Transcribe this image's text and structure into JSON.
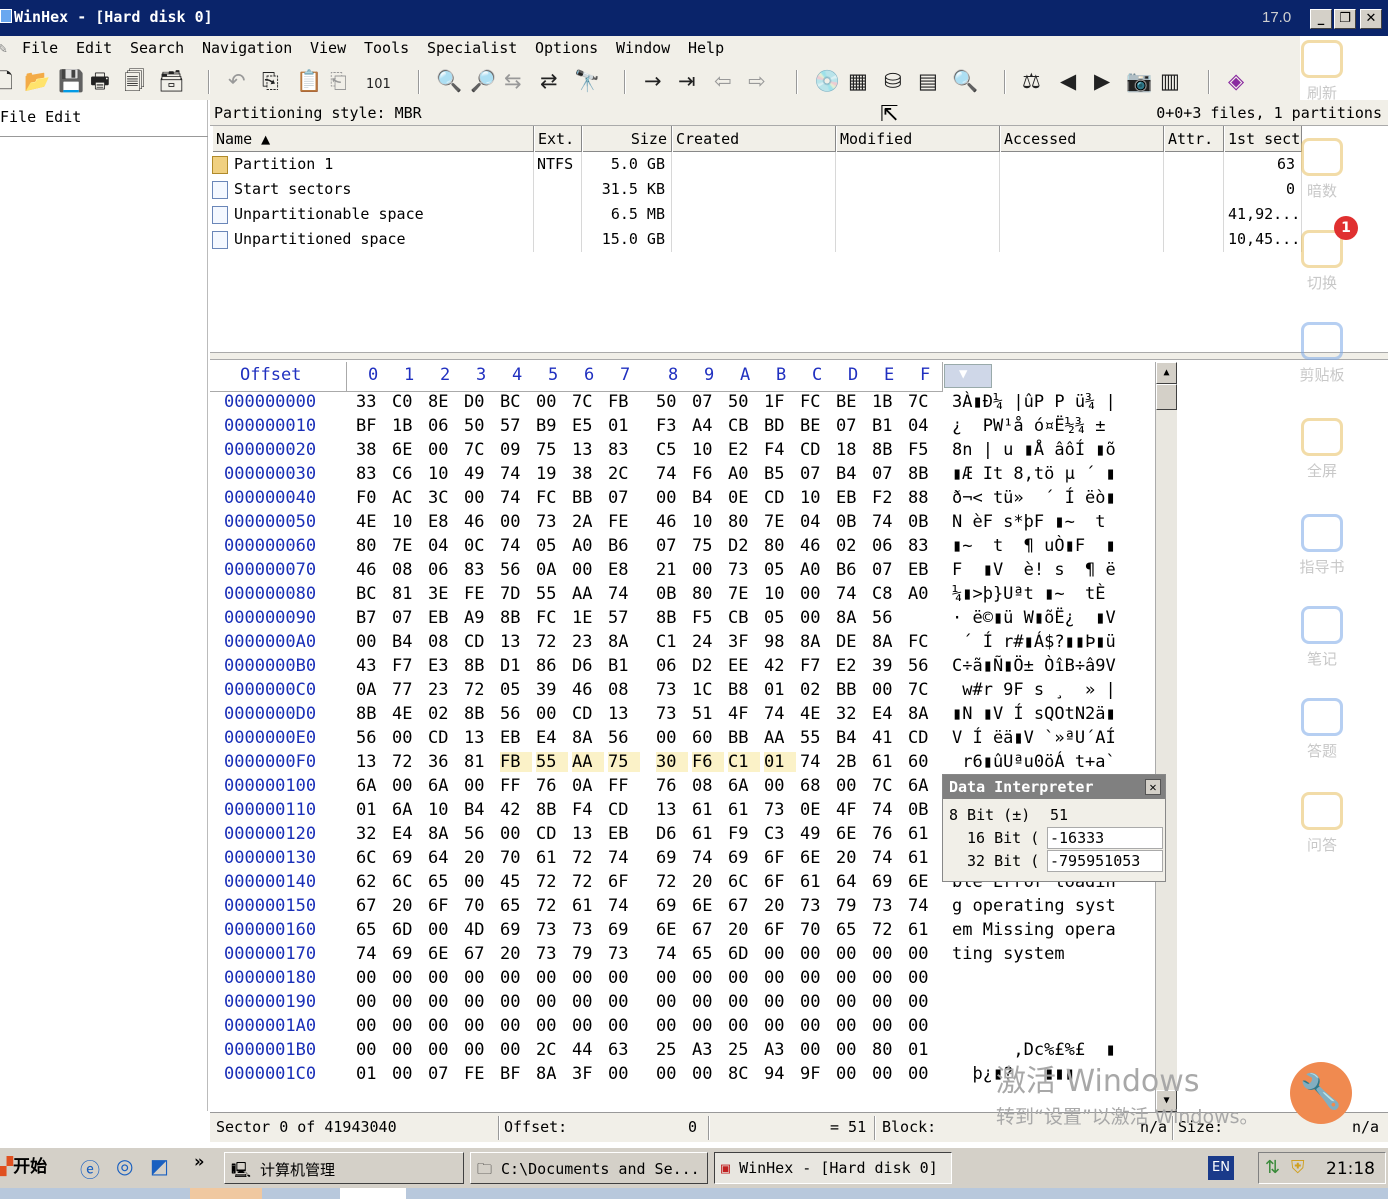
{
  "window": {
    "title": "WinHex - [Hard disk 0]",
    "version": "17.0",
    "min_label": "_",
    "max_label": "❐",
    "close_label": "✕"
  },
  "menu": [
    "File",
    "Edit",
    "Search",
    "Navigation",
    "View",
    "Tools",
    "Specialist",
    "Options",
    "Window",
    "Help"
  ],
  "left_pane": {
    "header": "File Edit"
  },
  "partition_bar": {
    "style": "Partitioning style: MBR",
    "summary": "0+0+3 files, 1 partitions"
  },
  "table": {
    "headers": [
      "Name ▲",
      "Ext.",
      "Size",
      "Created",
      "Modified",
      "Accessed",
      "Attr.",
      "1st sect"
    ],
    "rows": [
      {
        "name": "Partition 1",
        "ext": "NTFS",
        "size": "5.0 GB",
        "sector": "63"
      },
      {
        "name": "Start sectors",
        "ext": "",
        "size": "31.5 KB",
        "sector": "0"
      },
      {
        "name": "Unpartitionable space",
        "ext": "",
        "size": "6.5 MB",
        "sector": "41,92..."
      },
      {
        "name": "Unpartitioned space",
        "ext": "",
        "size": "15.0 GB",
        "sector": "10,45..."
      }
    ]
  },
  "hex": {
    "offset_label": "Offset",
    "columns": [
      "0",
      "1",
      "2",
      "3",
      "4",
      "5",
      "6",
      "7",
      "8",
      "9",
      "A",
      "B",
      "C",
      "D",
      "E",
      "F"
    ],
    "rows": [
      {
        "off": "000000000",
        "b": "33 C0 8E D0 BC 00 7C FB 50 07 50 1F FC BE 1B 7C",
        "t": "3À▮Ð¼ |ûP P ü¾ |"
      },
      {
        "off": "000000010",
        "b": "BF 1B 06 50 57 B9 E5 01 F3 A4 CB BD BE 07 B1 04",
        "t": "¿  PW¹å ó¤Ë½¾ ±"
      },
      {
        "off": "000000020",
        "b": "38 6E 00 7C 09 75 13 83 C5 10 E2 F4 CD 18 8B F5",
        "t": "8n | u ▮Å âôÍ ▮õ"
      },
      {
        "off": "000000030",
        "b": "83 C6 10 49 74 19 38 2C 74 F6 A0 B5 07 B4 07 8B",
        "t": "▮Æ It 8,tö µ ´ ▮"
      },
      {
        "off": "000000040",
        "b": "F0 AC 3C 00 74 FC BB 07 00 B4 0E CD 10 EB F2 88",
        "t": "ð¬< tü»  ´ Í ëò▮"
      },
      {
        "off": "000000050",
        "b": "4E 10 E8 46 00 73 2A FE 46 10 80 7E 04 0B 74 0B",
        "t": "N èF s*þF ▮~  t"
      },
      {
        "off": "000000060",
        "b": "80 7E 04 0C 74 05 A0 B6 07 75 D2 80 46 02 06 83",
        "t": "▮~  t  ¶ uÒ▮F  ▮"
      },
      {
        "off": "000000070",
        "b": "46 08 06 83 56 0A 00 E8 21 00 73 05 A0 B6 07 EB",
        "t": "F  ▮V  è! s  ¶ ë"
      },
      {
        "off": "000000080",
        "b": "BC 81 3E FE 7D 55 AA 74 0B 80 7E 10 00 74 C8 A0",
        "t": "¼▮>þ}Uªt ▮~  tÈ"
      },
      {
        "off": "000000090",
        "b": "B7 07 EB A9 8B FC 1E 57 8B F5 CB 05 00 8A 56",
        "t": "· ë©▮ü W▮õË¿  ▮V"
      },
      {
        "off": "0000000A0",
        "b": "00 B4 08 CD 13 72 23 8A C1 24 3F 98 8A DE 8A FC",
        "t": " ´ Í r#▮Á$?▮▮Þ▮ü"
      },
      {
        "off": "0000000B0",
        "b": "43 F7 E3 8B D1 86 D6 B1 06 D2 EE 42 F7 E2 39 56",
        "t": "C÷ã▮Ñ▮Ö± ÒîB÷â9V"
      },
      {
        "off": "0000000C0",
        "b": "0A 77 23 72 05 39 46 08 73 1C B8 01 02 BB 00 7C",
        "t": " w#r 9F s ¸  » |"
      },
      {
        "off": "0000000D0",
        "b": "8B 4E 02 8B 56 00 CD 13 73 51 4F 74 4E 32 E4 8A",
        "t": "▮N ▮V Í sQOtN2ä▮"
      },
      {
        "off": "0000000E0",
        "b": "56 00 CD 13 EB E4 8A 56 00 60 BB AA 55 B4 41 CD",
        "t": "V Í ëä▮V `»ªU´AÍ"
      },
      {
        "off": "0000000F0",
        "b": "13 72 36 81 FB 55 AA 75 30 F6 C1 01 74 2B 61 60",
        "t": " r6▮ûUªu0öÁ t+a`"
      },
      {
        "off": "000000100",
        "b": "6A 00 6A 00 FF 76 0A FF 76 08 6A 00 68 00 7C 6A",
        "t": "j j ÿv ÿv j h |j"
      },
      {
        "off": "000000110",
        "b": "01 6A 10 B4 42 8B F4 CD 13 61 61 73 0E 4F 74 0B",
        "t": " j ´B▮ôÍ aas Ot"
      },
      {
        "off": "000000120",
        "b": "32 E4 8A 56 00 CD 13 EB D6 61 F9 C3 49 6E 76 61",
        "t": "2ä▮V Í ëÖaùÃInva"
      },
      {
        "off": "000000130",
        "b": "6C 69 64 20 70 61 72 74 69 74 69 6F 6E 20 74 61",
        "t": "lid partition ta"
      },
      {
        "off": "000000140",
        "b": "62 6C 65 00 45 72 72 6F 72 20 6C 6F 61 64 69 6E",
        "t": "ble Error loadin"
      },
      {
        "off": "000000150",
        "b": "67 20 6F 70 65 72 61 74 69 6E 67 20 73 79 73 74",
        "t": "g operating syst"
      },
      {
        "off": "000000160",
        "b": "65 6D 00 4D 69 73 73 69 6E 67 20 6F 70 65 72 61",
        "t": "em Missing opera"
      },
      {
        "off": "000000170",
        "b": "74 69 6E 67 20 73 79 73 74 65 6D 00 00 00 00 00",
        "t": "ting system"
      },
      {
        "off": "000000180",
        "b": "00 00 00 00 00 00 00 00 00 00 00 00 00 00 00 00",
        "t": ""
      },
      {
        "off": "000000190",
        "b": "00 00 00 00 00 00 00 00 00 00 00 00 00 00 00 00",
        "t": ""
      },
      {
        "off": "0000001A0",
        "b": "00 00 00 00 00 00 00 00 00 00 00 00 00 00 00 00",
        "t": ""
      },
      {
        "off": "0000001B0",
        "b": "00 00 00 00 00 2C 44 63 25 A3 25 A3 00 00 80 01",
        "t": "      ,Dc%£%£  ▮"
      },
      {
        "off": "0000001C0",
        "b": "01 00 07 FE BF 8A 3F 00 00 00 8C 94 9F 00 00 00",
        "t": "  þ¿▮?   ▮▮▮"
      }
    ]
  },
  "data_interpreter": {
    "title": "Data Interpreter",
    "close_label": "✕",
    "rows": [
      {
        "label": "8 Bit (±)",
        "value": "51"
      },
      {
        "label": "16 Bit (",
        "value": "-16333"
      },
      {
        "label": "32 Bit (",
        "value": "-795951053"
      }
    ]
  },
  "status": {
    "sector": "Sector 0 of 41943040",
    "offset_label": "Offset:",
    "offset_value": "0",
    "value": "= 51",
    "block_label": "Block:",
    "block_value": "n/a",
    "size_label": "Size:",
    "size_value": "n/a"
  },
  "taskbar": {
    "start": "开始",
    "tasks": [
      "计算机管理",
      "C:\\Documents and Se...",
      "WinHex - [Hard disk 0]"
    ],
    "lang": "EN",
    "clock": "21:18"
  },
  "side_panel": {
    "items": [
      "刷新",
      "暗数",
      "切换",
      "剪贴板",
      "全屏",
      "指导书",
      "笔记",
      "答题",
      "问答"
    ],
    "badge": "1"
  },
  "watermark": {
    "line1": "激活 Windows",
    "line2": "转到“设置”以激活 Windows。"
  },
  "colors": {
    "title_bar": "#0a246a",
    "chrome": "#f1efe8",
    "offset_blue": "#1a2fb8",
    "selection": "#fbf2c8"
  }
}
